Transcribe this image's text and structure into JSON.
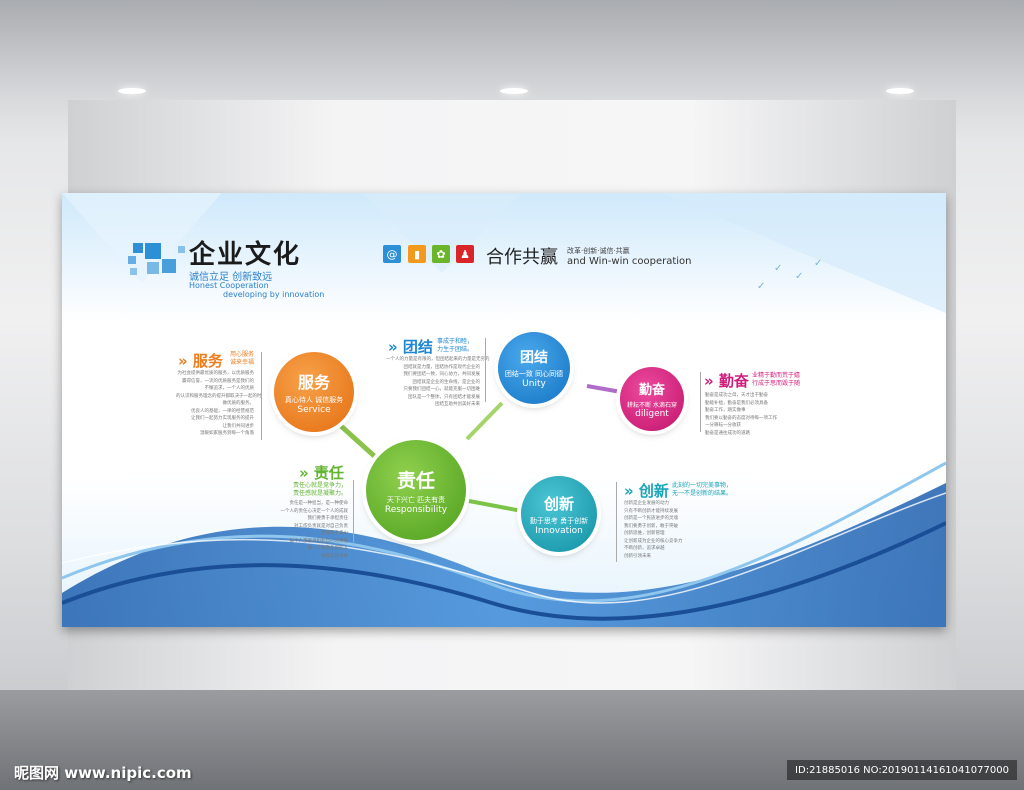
{
  "title": "企业文化",
  "subtitle_cn": "诚信立足 创新致远",
  "subtitle_en1": "Honest Cooperation",
  "subtitle_en2": "developing by innovation",
  "cooperate": "合作共赢",
  "cooperate_small": "改革·创新·诚信·共赢",
  "cooperate_en": "and Win-win  cooperation",
  "icons": [
    "at-icon",
    "chart-icon",
    "gear-icon",
    "person-icon"
  ],
  "circles": {
    "service": {
      "cn": "服务",
      "sub": "真心待人 诚信服务",
      "en": "Service",
      "color": "#ee7d1e"
    },
    "unity": {
      "cn": "团结",
      "sub": "团结一致 同心同德",
      "en": "Unity",
      "color": "#1d87d3"
    },
    "diligent": {
      "cn": "勤奋",
      "sub": "耕耘不断 水滴石穿",
      "en": "diligent",
      "color": "#d11c7b"
    },
    "responsibility": {
      "cn": "责任",
      "sub": "天下兴亡 匹夫有责",
      "en": "Responsibility",
      "color": "#62b530"
    },
    "innovation": {
      "cn": "创新",
      "sub": "勤于思考 勇于创新",
      "en": "Innovation",
      "color": "#1aa4b8"
    }
  },
  "sections": {
    "service": {
      "head": "服务",
      "tag": "用心服务\n诚来幸福",
      "text": "为社会提供最优质的服务，以优质服务\n赢得信誉，一流的优质服务是我们的\n不懈追求，一个人的优质\n的认识和服务理念的提升都取决于一起的时\n做优质的服务。\n优良人的基础，一律的经营规范\n让我们一起努力实现服务的提升\n让我们共同进步\n温暖如家服务到每一个角落"
    },
    "unity": {
      "head": "团结",
      "tag": "事成于和睦，\n力生于团结。",
      "text": "一个人的力量是有限的，但团结起来的力量是无穷的\n团结就是力量，团结协作是现代企业的\n我们要团结一致，同心协力，共同发展\n团结就是企业的生命线，是企业的\n只要我们团结一心，就能克服一切困难\n团队是一个整体，只有团结才能发展\n团结互助共创美好未来"
    },
    "diligent": {
      "head": "勤奋",
      "tag": "业精于勤而荒于嬉\n行成于思而毁于随",
      "text": "勤奋是成功之母，天才出于勤奋\n勤能补拙，勤奋是我们必须具备\n勤奋工作，踏实做事\n我们要以勤奋的态度对待每一项工作\n一分耕耘一分收获\n勤奋是通往成功的道路"
    },
    "responsibility": {
      "head": "责任",
      "tag": "责任心就是竞争力，\n责任感就是凝聚力。",
      "text": "责任是一种担当，是一种使命\n一个人的责任心决定一个人的成就\n我们要勇于承担责任\n对工作负责就是对自己负责\n责任重于泰山\n每个人都要承担起自己的责任\n做一个有责任感的人\n责任成就未来"
    },
    "innovation": {
      "head": "创新",
      "tag": "此刻的一切完美事物，\n无一不是创新的结果。",
      "text": "创新是企业发展的动力\n只有不断创新才能持续发展\n创新是一个民族进步的灵魂\n我们要勇于创新，敢于突破\n创新思维，创新管理\n让创新成为企业的核心竞争力\n不断创新，追求卓越\n创新引领未来"
    }
  },
  "watermark_left": "昵图网 www.nipic.com",
  "watermark_right": "ID:21885016 NO:20190114161041077000",
  "colors": {
    "brand_blue": "#2d8fd5",
    "wave_dark": "#1f5fae",
    "wave_light": "#6fb6e8"
  }
}
